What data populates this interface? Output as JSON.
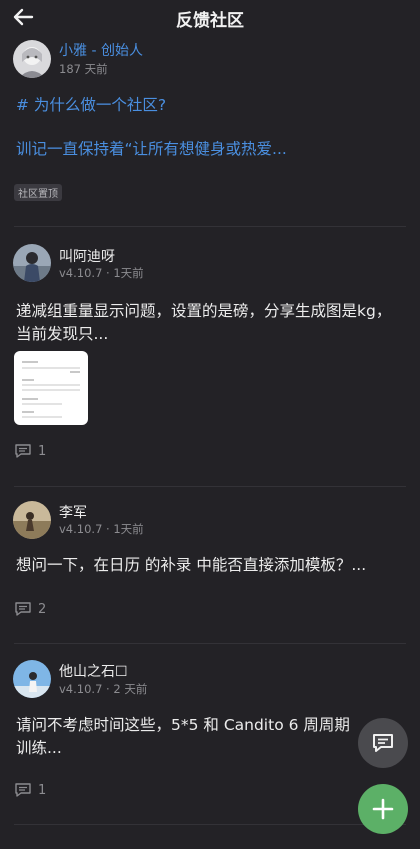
{
  "header": {
    "title": "反馈社区",
    "back_icon": "arrow-left-icon"
  },
  "pinned_post": {
    "author": "小雅 - 创始人",
    "time": "187 天前",
    "line1": "# 为什么做一个社区?",
    "line2": "训记一直保持着“让所有想健身或热爱...",
    "badge": "社区置顶"
  },
  "posts": [
    {
      "author": "叫阿迪呀",
      "meta": "v4.10.7 · 1天前",
      "text": "递减组重量显示问题，设置的是磅，分享生成图是kg，当前发现只...",
      "comments": "1",
      "has_image": true
    },
    {
      "author": "李军",
      "meta": "v4.10.7 · 1天前",
      "text": "想问一下，在日历 的补录 中能否直接添加模板？...",
      "comments": "2"
    },
    {
      "author": "他山之石☐",
      "meta": "v4.10.7 · 2 天前",
      "text": "请问不考虑时间这些，5*5 和 Candito 6 周周期训练...",
      "comments": "1"
    }
  ],
  "fabs": {
    "feedback_icon": "message-square-icon",
    "add_icon": "plus-icon"
  },
  "colors": {
    "background": "#232226",
    "accent": "#4a8fe0",
    "fab_green": "#5cb067",
    "fab_gray": "#4a4a4e"
  }
}
